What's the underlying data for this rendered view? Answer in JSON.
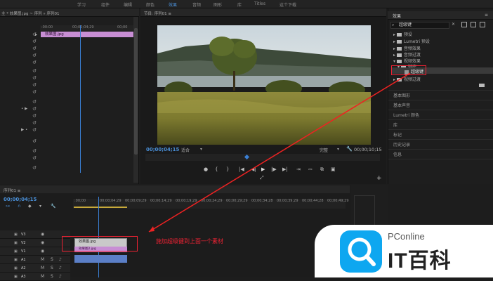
{
  "topbar": {
    "workspaces": [
      "学习",
      "组件",
      "编辑",
      "颜色",
      "效果",
      "音频",
      "图形",
      "库",
      "Titles",
      "这个下载"
    ],
    "active_index": 4
  },
  "effect_controls": {
    "title": "主 * 效果图.jpg  ~  序列 » 序列01",
    "ruler": [
      ":00:00",
      "00;00;04;29",
      "00;00"
    ],
    "clip_label": "效果图.jpg",
    "toggles": [
      "• ▶",
      "▶ •"
    ]
  },
  "program_monitor": {
    "title": "节目: 序列01  ≡",
    "timecode_left": "00;00;04;15",
    "fit": "适合",
    "quality": "完整",
    "timecode_right": "00;00;10;15",
    "controls": [
      "●",
      "{",
      "}",
      "|◀",
      "◀|",
      "▶",
      "|▶",
      "▶|",
      "⇥",
      "⎓",
      "⧉",
      "▣",
      "⤢"
    ],
    "add_label": "+"
  },
  "effects": {
    "title": "效果",
    "search_value": "超级键",
    "tree": [
      {
        "label": "预设",
        "indent": 0
      },
      {
        "label": "Lumetri 预设",
        "indent": 0
      },
      {
        "label": "音频效果",
        "indent": 0
      },
      {
        "label": "音频过渡",
        "indent": 0
      },
      {
        "label": "视频效果",
        "indent": 0
      },
      {
        "label": "键控",
        "indent": 1
      },
      {
        "label": "超级键",
        "indent": 2
      },
      {
        "label": "视频过渡",
        "indent": 0
      }
    ],
    "categories": [
      "基本图形",
      "基本声音",
      "Lumetri 颜色",
      "库",
      "标记",
      "历史记录",
      "信息"
    ]
  },
  "timeline": {
    "title": "序列01  ≡",
    "timecode": "00;00;04;15",
    "ruler": [
      ":00;00",
      "00;00;04;29",
      "00;00;09;29",
      "00;00;14;29",
      "00;00;19;29",
      "00;00;24;29",
      "00;00;29;29",
      "00;00;34;28",
      "00;00;39;29",
      "00;00;44;28",
      "00;00;49;29"
    ],
    "tracks": [
      {
        "id": "V3"
      },
      {
        "id": "V2"
      },
      {
        "id": "V1"
      },
      {
        "id": "A1"
      },
      {
        "id": "A2"
      },
      {
        "id": "A3"
      }
    ],
    "clip_v2_label": "效果图.jpg",
    "clip_v1_label": "效果图2.jpg",
    "annotation": "施加超级键到上面一个素材"
  },
  "watermark": {
    "brand": "PConline",
    "logo_text": "IT百科"
  },
  "colors": {
    "accent": "#3a7fd4",
    "clip_pink": "#c88ed4",
    "highlight_red": "#e22"
  }
}
